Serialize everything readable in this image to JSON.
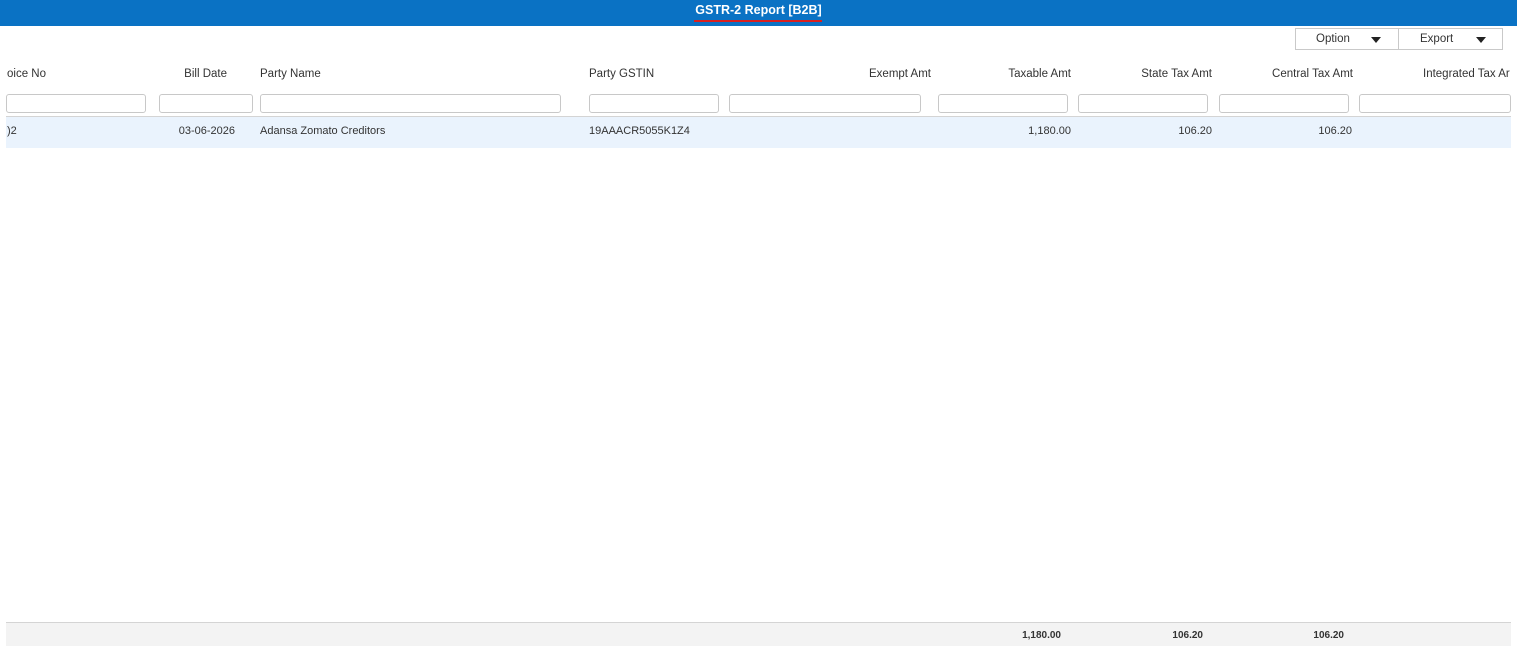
{
  "header": {
    "title": "GSTR-2 Report [B2B]"
  },
  "toolbar": {
    "option_label": "Option",
    "export_label": "Export"
  },
  "columns": {
    "invoice_no": "oice No",
    "bill_date": "Bill Date",
    "party_name": "Party Name",
    "party_gstin": "Party GSTIN",
    "exempt_amt": "Exempt Amt",
    "taxable_amt": "Taxable Amt",
    "state_tax_amt": "State Tax Amt",
    "central_tax_amt": "Central Tax Amt",
    "integrated_tax_amt": "Integrated Tax Ar"
  },
  "filters": {
    "invoice_no": "",
    "bill_date": "",
    "party_name": "",
    "party_gstin": "",
    "exempt_amt": "",
    "taxable_amt": "",
    "state_tax_amt": "",
    "central_tax_amt": "",
    "integrated_tax_amt": ""
  },
  "rows": [
    {
      "invoice_no": ")2",
      "bill_date": "03-06-2026",
      "party_name": "Adansa Zomato Creditors",
      "party_gstin": "19AAACR5055K1Z4",
      "taxable_amt": "1,180.00",
      "state_tax_amt": "106.20",
      "central_tax_amt": "106.20"
    }
  ],
  "totals": {
    "taxable_amt": "1,180.00",
    "state_tax_amt": "106.20",
    "central_tax_amt": "106.20"
  }
}
